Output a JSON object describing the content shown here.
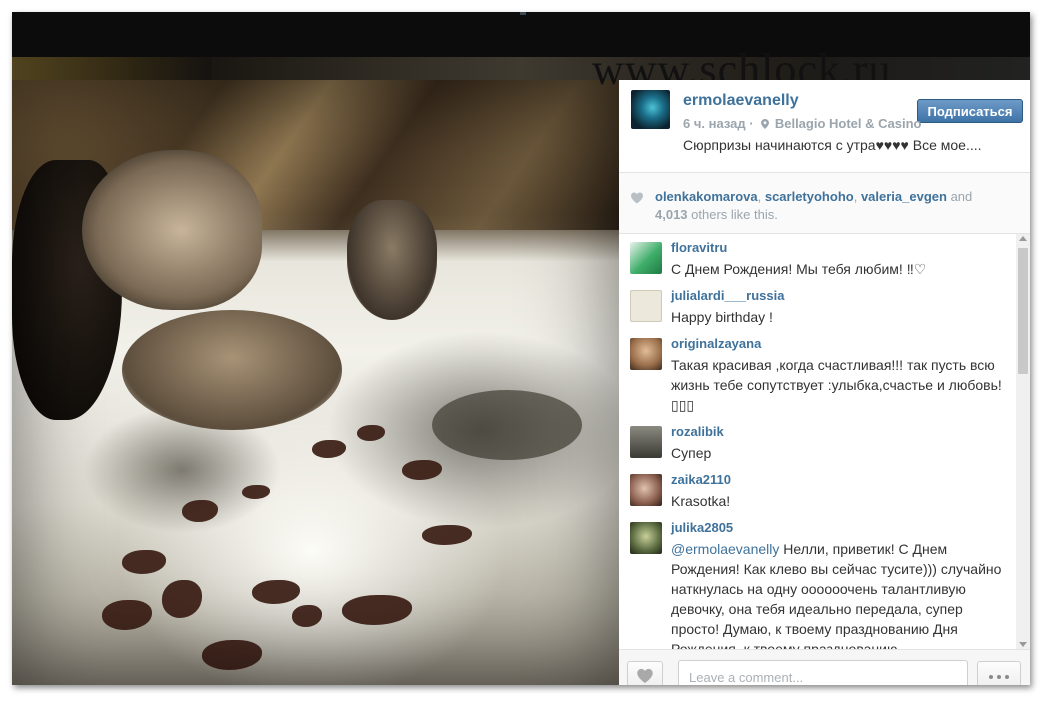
{
  "watermark": "www.schlock.ru",
  "post": {
    "username": "ermolaevanelly",
    "follow_label": "Подписаться",
    "time_ago": "6 ч. назад",
    "location": "Bellagio Hotel & Casino",
    "caption": "Сюрпризы начинаются с утра♥♥♥♥ Все мое...."
  },
  "likes": {
    "users": [
      "olenkakomarova",
      "scarletyohoho",
      "valeria_evgen"
    ],
    "sep1": ", ",
    "sep2": ", ",
    "and_text": " and",
    "count": "4,013",
    "suffix": " others like this."
  },
  "comments": [
    {
      "user": "floravitru",
      "text": "С Днем Рождения! Мы тебя любим! ‼♡",
      "avatar_color": "#3fae6a"
    },
    {
      "user": "julialardi___russia",
      "text": "Happy birthday !",
      "avatar_color": "#d9d4c6"
    },
    {
      "user": "originalzayana",
      "text": "Такая красивая ,когда счастливая!!! так пусть всю жизнь тебе сопутствует :улыбка,счастье и любовь!▯▯▯",
      "avatar_color": "#c9a27a"
    },
    {
      "user": "rozalibik",
      "text": "Супер",
      "avatar_color": "#6a6a62"
    },
    {
      "user": "zaika2110",
      "text": "Krasotka!",
      "avatar_color": "#b08a7a"
    },
    {
      "user": "julika2805",
      "mention": "@ermolaevanelly",
      "text": " Нелли, приветик! С Днем Рождения! Как клево вы сейчас тусите))) случайно наткнулась на одну оооооочень талантливую девочку, она тебя идеально передала, супер просто! Думаю, к твоему празднованию Дня Рождения, к твоему празднованию",
      "avatar_color": "#5a6a40"
    }
  ],
  "footer": {
    "comment_placeholder": "Leave a comment..."
  },
  "colors": {
    "link": "#3f729b",
    "follow_button": "#3f74a8"
  }
}
